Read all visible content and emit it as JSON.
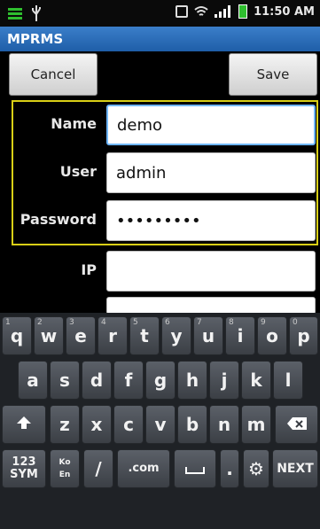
{
  "status": {
    "time": "11:50 AM"
  },
  "app": {
    "title": "MPRMS"
  },
  "actions": {
    "cancel": "Cancel",
    "save": "Save"
  },
  "form": {
    "name_label": "Name",
    "name_value": "demo",
    "user_label": "User",
    "user_value": "admin",
    "password_label": "Password",
    "password_value": "•••••••••",
    "ip_label": "IP",
    "ip_value": ""
  },
  "keyboard": {
    "row1": [
      "q",
      "w",
      "e",
      "r",
      "t",
      "y",
      "u",
      "i",
      "o",
      "p"
    ],
    "row1_hints": [
      "1",
      "2",
      "3",
      "4",
      "5",
      "6",
      "7",
      "8",
      "9",
      "0"
    ],
    "row2": [
      "a",
      "s",
      "d",
      "f",
      "g",
      "h",
      "j",
      "k",
      "l"
    ],
    "row3": [
      "z",
      "x",
      "c",
      "v",
      "b",
      "n",
      "m"
    ],
    "sym": "123\nSYM",
    "lang": "Ko\nEn",
    "slash": "/",
    "dotcom": ".com",
    "period": ".",
    "next": "NEXT"
  },
  "colors": {
    "title_bar": "#2a6cb8",
    "focus_border": "#d9cf16"
  }
}
